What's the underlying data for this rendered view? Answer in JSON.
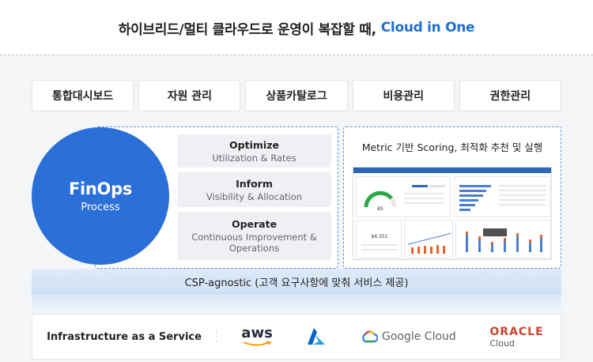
{
  "header": {
    "title_main": "하이브리드/멀티 클라우드로 운영이 복잡할 때,",
    "title_accent": "Cloud in One"
  },
  "tabs": [
    {
      "label": "통합대시보드"
    },
    {
      "label": "자원 관리"
    },
    {
      "label": "상품카탈로그"
    },
    {
      "label": "비용관리"
    },
    {
      "label": "권한관리"
    }
  ],
  "finops": {
    "title": "FinOps",
    "subtitle": "Process"
  },
  "process": [
    {
      "title": "Optimize",
      "desc": "Utilization & Rates"
    },
    {
      "title": "Inform",
      "desc": "Visibility & Allocation"
    },
    {
      "title": "Operate",
      "desc": "Continuous Improvement & Operations"
    }
  ],
  "metric": {
    "title": "Metric 기반 Scoring, 최적화 추천 및 실행",
    "gauge_value": "85",
    "cost_value": "$6,351"
  },
  "csp": {
    "label": "CSP-agnostic (고객 요구사항에 맞춰 서비스 제공)"
  },
  "infra": {
    "label": "Infrastructure as a Service",
    "providers": {
      "aws": "aws",
      "azure": "Azure",
      "google": "Google Cloud",
      "oracle_main": "ORACLE",
      "oracle_sub": "Cloud"
    }
  },
  "colors": {
    "accent": "#1f6fd6",
    "circle": "#2b6fd9",
    "oracle": "#c74634"
  }
}
